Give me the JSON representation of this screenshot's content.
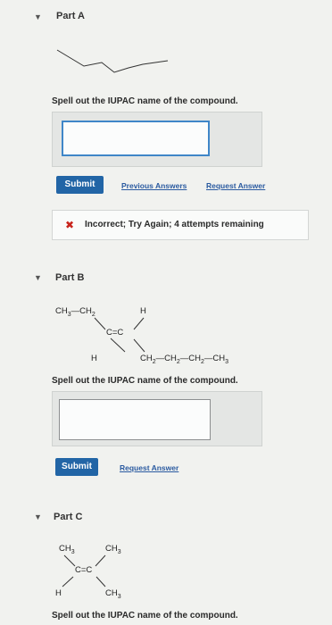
{
  "partA": {
    "title": "Part A",
    "prompt": "Spell out the IUPAC name of the compound.",
    "input_value": "",
    "submit_label": "Submit",
    "previous_answers_label": "Previous Answers",
    "request_answer_label": "Request Answer",
    "feedback": "Incorrect; Try Again; 4 attempts remaining"
  },
  "partB": {
    "title": "Part B",
    "prompt": "Spell out the IUPAC name of the compound.",
    "input_value": "",
    "submit_label": "Submit",
    "request_answer_label": "Request Answer",
    "structure": {
      "top_left_group": "CH3—CH2",
      "top_right": "H",
      "double_bond": "C=C",
      "bottom_left": "H",
      "bottom_right_group": "CH2—CH2—CH2—CH3"
    }
  },
  "partC": {
    "title": "Part C",
    "prompt": "Spell out the IUPAC name of the compound.",
    "structure": {
      "top_left_group": "CH3",
      "top_right_group": "CH3",
      "double_bond": "C=C",
      "bottom_left": "H",
      "bottom_right_group": "CH3"
    }
  },
  "colors": {
    "accent": "#2265a6",
    "input_focus": "#3f86c8",
    "error": "#c8241c",
    "link": "#2a5aa0"
  }
}
